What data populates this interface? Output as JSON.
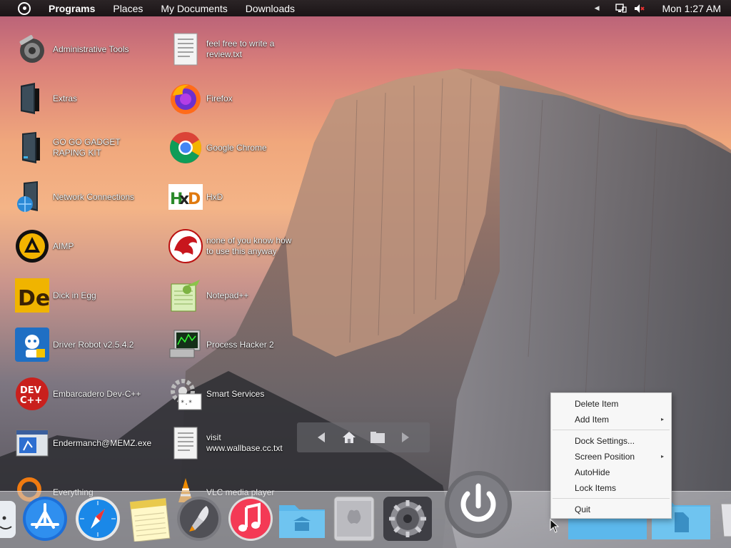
{
  "menubar": {
    "items": [
      "Programs",
      "Places",
      "My Documents",
      "Downloads"
    ],
    "clock": "Mon 1:27 AM"
  },
  "desktop": {
    "column1": [
      {
        "label": "Administrative Tools",
        "icon": "admin-tools-icon"
      },
      {
        "label": "Extras",
        "icon": "folder-icon"
      },
      {
        "label": "GO GO GADGET RAPING KIT",
        "icon": "folder-icon"
      },
      {
        "label": "Network Connections",
        "icon": "network-icon"
      },
      {
        "label": "AIMP",
        "icon": "aimp-icon"
      },
      {
        "label": "Dick in Egg",
        "icon": "de-icon"
      },
      {
        "label": "Driver Robot v2.5.4.2",
        "icon": "driver-robot-icon"
      },
      {
        "label": "Embarcadero Dev-C++",
        "icon": "devcpp-icon"
      },
      {
        "label": "Endermanch@MEMZ.exe",
        "icon": "exe-icon"
      },
      {
        "label": "Everything",
        "icon": "everything-icon"
      }
    ],
    "column2": [
      {
        "label": "feel free to write a review.txt",
        "icon": "text-file-icon"
      },
      {
        "label": "Firefox",
        "icon": "firefox-icon"
      },
      {
        "label": "Google Chrome",
        "icon": "chrome-icon"
      },
      {
        "label": "HxD",
        "icon": "hxd-icon"
      },
      {
        "label": "none of you know how to use this anyway",
        "icon": "dragon-icon"
      },
      {
        "label": "Notepad++",
        "icon": "notepadpp-icon"
      },
      {
        "label": "Process Hacker 2",
        "icon": "process-hacker-icon"
      },
      {
        "label": "Smart Services",
        "icon": "gear-icon"
      },
      {
        "label": "visit www.wallbase.cc.txt",
        "icon": "text-file-icon"
      },
      {
        "label": "VLC media player",
        "icon": "vlc-icon"
      }
    ]
  },
  "dock": {
    "items": [
      "finder-icon",
      "app-store-icon",
      "safari-icon",
      "notes-icon",
      "launchpad-icon",
      "itunes-icon",
      "library-folder-icon",
      "mac-pro-icon",
      "system-preferences-icon",
      "power-icon",
      "blue-folder-icon",
      "document-folder-icon",
      "trash-icon"
    ]
  },
  "context_menu": {
    "items": [
      {
        "label": "Delete Item",
        "submenu": false
      },
      {
        "label": "Add Item",
        "submenu": true
      },
      {
        "label": "Dock Settings...",
        "submenu": false
      },
      {
        "label": "Screen Position",
        "submenu": true
      },
      {
        "label": "AutoHide",
        "submenu": false
      },
      {
        "label": "Lock Items",
        "submenu": false
      },
      {
        "label": "Quit",
        "submenu": false
      }
    ]
  }
}
